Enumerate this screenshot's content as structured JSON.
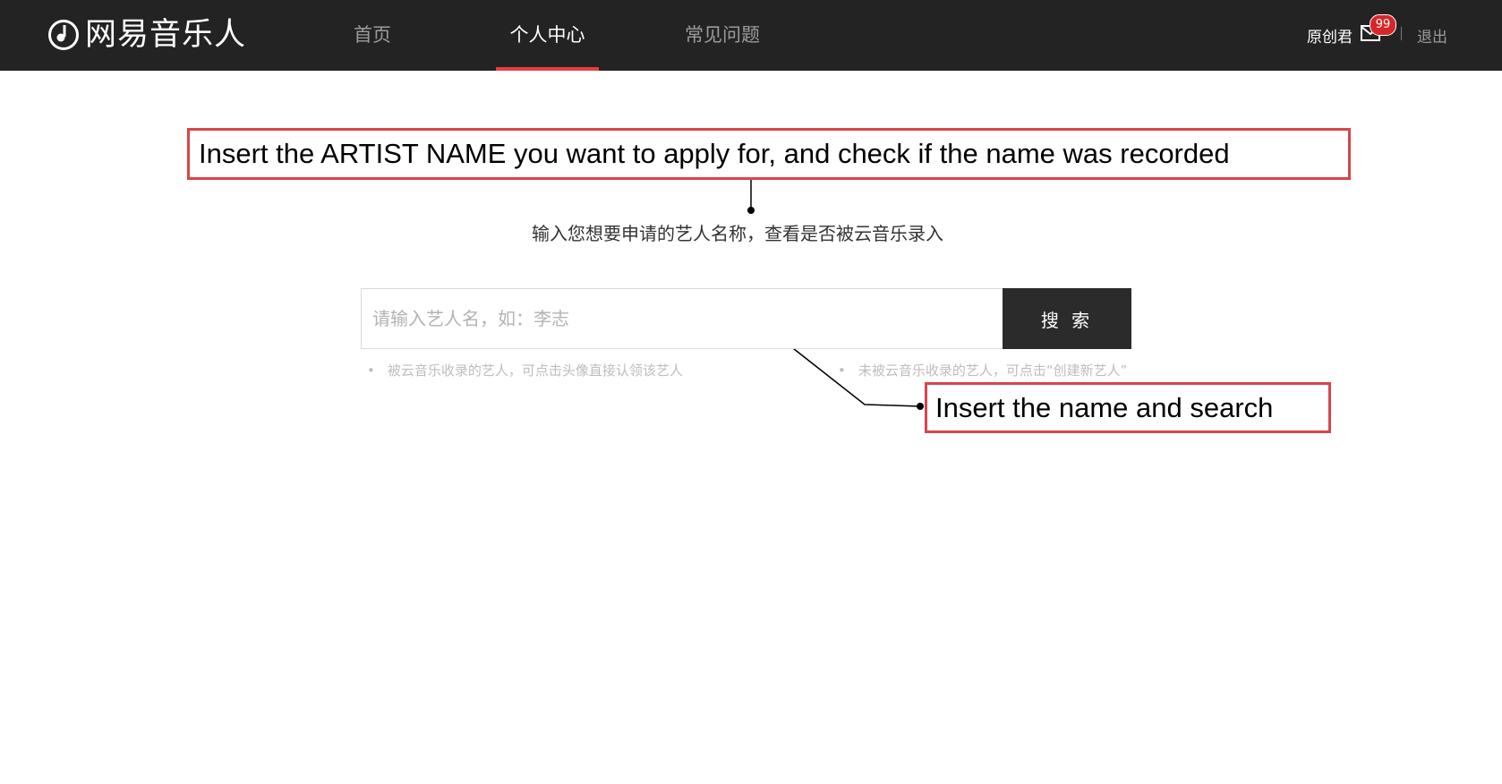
{
  "app": {
    "logo_text": "网易音乐人",
    "nav": [
      {
        "label": "首页",
        "active": false
      },
      {
        "label": "个人中心",
        "active": true
      },
      {
        "label": "常见问题",
        "active": false
      }
    ],
    "user_name": "原创君",
    "mail_badge_count": "99",
    "logout_label": "退出"
  },
  "main": {
    "lead_text": "输入您想要申请的艺人名称，查看是否被云音乐录入",
    "search_placeholder": "请输入艺人名，如：李志",
    "search_button_label": "搜 索",
    "hint_left": "被云音乐收录的艺人，可点击头像直接认领该艺人",
    "hint_right": "未被云音乐收录的艺人，可点击“创建新艺人”",
    "bullet": "•"
  },
  "annotations": {
    "top_callout": "Insert the ARTIST NAME you want to apply for, and check if the name was recorded",
    "search_callout": "Insert the name and search"
  },
  "colors": {
    "topbar_bg": "#232323",
    "active_underline": "#e64040",
    "badge_bg": "#d7262a",
    "callout_border": "#d9444a",
    "search_button_bg": "#2b2b2b"
  },
  "icons": [
    "music-note-logo-icon",
    "mail-icon"
  ]
}
